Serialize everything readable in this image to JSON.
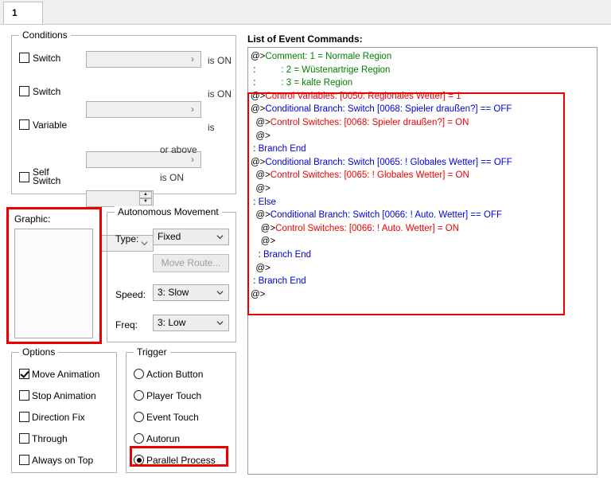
{
  "tab": {
    "label": "1"
  },
  "conditions": {
    "title": "Conditions",
    "rows": [
      {
        "label": "Switch",
        "checked": false,
        "field_value": "",
        "arrow": "›",
        "suffix": "is ON"
      },
      {
        "label": "Switch",
        "checked": false,
        "field_value": "",
        "arrow": "›",
        "suffix": "is ON"
      },
      {
        "label": "Variable",
        "checked": false,
        "field_value": "",
        "arrow": "›",
        "suffix": "is"
      }
    ],
    "variable_spinner": {
      "value": "",
      "suffix": "or above",
      "up": "▲",
      "down": "▼"
    },
    "self_switch": {
      "label_line1": "Self",
      "label_line2": "Switch",
      "checked": false,
      "value": "",
      "suffix": "is ON"
    }
  },
  "graphic": {
    "title": "Graphic:",
    "highlight_color": "#ee0000"
  },
  "autonomous": {
    "title": "Autonomous Movement",
    "type_label": "Type:",
    "type_value": "Fixed",
    "move_route_label": "Move Route...",
    "speed_label": "Speed:",
    "speed_value": "3: Slow",
    "freq_label": "Freq:",
    "freq_value": "3: Low"
  },
  "options": {
    "title": "Options",
    "items": [
      {
        "label": "Move Animation",
        "checked": true
      },
      {
        "label": "Stop Animation",
        "checked": false
      },
      {
        "label": "Direction Fix",
        "checked": false
      },
      {
        "label": "Through",
        "checked": false
      },
      {
        "label": "Always on Top",
        "checked": false
      }
    ]
  },
  "trigger": {
    "title": "Trigger",
    "items": [
      {
        "label": "Action Button",
        "selected": false
      },
      {
        "label": "Player Touch",
        "selected": false
      },
      {
        "label": "Event Touch",
        "selected": false
      },
      {
        "label": "Autorun",
        "selected": false
      },
      {
        "label": "Parallel Process",
        "selected": true
      }
    ],
    "highlight_color": "#ee0000"
  },
  "event_commands": {
    "title": "List of Event Commands:",
    "highlight_color": "#ee0000",
    "lines": [
      {
        "prefix": "@>",
        "indent": 0,
        "text": "Comment: 1 = Normale Region",
        "color": "green"
      },
      {
        "prefix": " :",
        "indent": 0,
        "text": "          : 2 = Wüstenartrige Region",
        "color": "green"
      },
      {
        "prefix": " :",
        "indent": 0,
        "text": "          : 3 = kalte Region",
        "color": "green"
      },
      {
        "prefix": "@>",
        "indent": 0,
        "text": "Control Variables: [0050: Regionales Wetter] = 1",
        "color": "red"
      },
      {
        "prefix": "@>",
        "indent": 0,
        "text": "Conditional Branch: Switch [0068: Spieler draußen?] == OFF",
        "color": "blue"
      },
      {
        "prefix": "@>",
        "indent": 1,
        "text": "Control Switches: [0068: Spieler draußen?] = ON",
        "color": "red"
      },
      {
        "prefix": "@>",
        "indent": 1,
        "text": "",
        "color": "black"
      },
      {
        "prefix": " :",
        "indent": 0,
        "text": " Branch End",
        "color": "blue"
      },
      {
        "prefix": "@>",
        "indent": 0,
        "text": "Conditional Branch: Switch [0065: ! Globales Wetter] == OFF",
        "color": "blue"
      },
      {
        "prefix": "@>",
        "indent": 1,
        "text": "Control Switches: [0065: ! Globales Wetter] = ON",
        "color": "red"
      },
      {
        "prefix": "@>",
        "indent": 1,
        "text": "",
        "color": "black"
      },
      {
        "prefix": " :",
        "indent": 0,
        "text": " Else",
        "color": "blue"
      },
      {
        "prefix": "@>",
        "indent": 1,
        "text": "Conditional Branch: Switch [0066: ! Auto. Wetter] == OFF",
        "color": "blue"
      },
      {
        "prefix": "@>",
        "indent": 2,
        "text": "Control Switches: [0066: ! Auto. Wetter] = ON",
        "color": "red"
      },
      {
        "prefix": "@>",
        "indent": 2,
        "text": "",
        "color": "black"
      },
      {
        "prefix": " :",
        "indent": 1,
        "text": " Branch End",
        "color": "blue"
      },
      {
        "prefix": "@>",
        "indent": 1,
        "text": "",
        "color": "black"
      },
      {
        "prefix": " :",
        "indent": 0,
        "text": " Branch End",
        "color": "blue"
      },
      {
        "prefix": "@>",
        "indent": 0,
        "text": "",
        "color": "black"
      }
    ]
  }
}
